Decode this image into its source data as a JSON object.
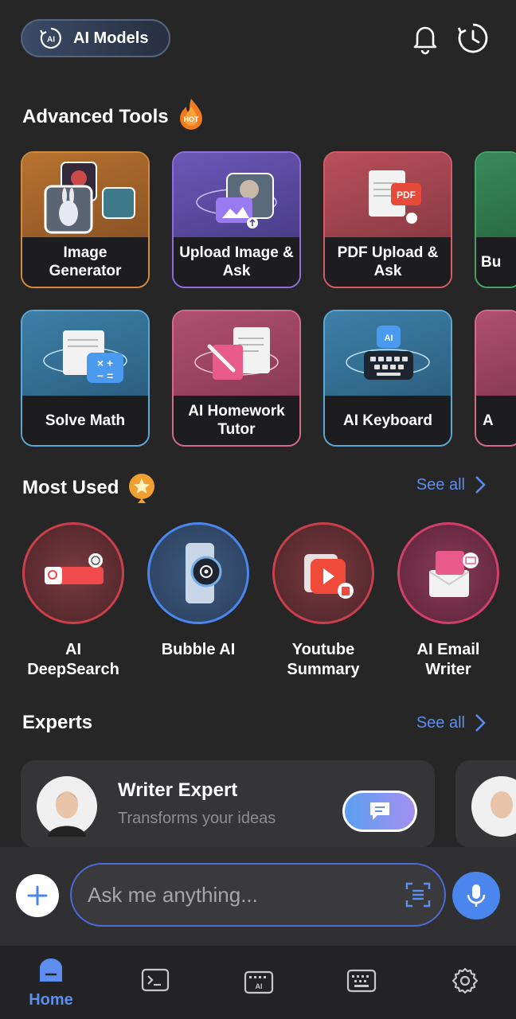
{
  "header": {
    "ai_models_label": "AI Models",
    "ai_badge_text": "AI",
    "icons": [
      "bell-icon",
      "history-icon"
    ]
  },
  "advanced_tools": {
    "title": "Advanced Tools",
    "hot_badge": "HOT",
    "tools": [
      {
        "label": "Image Generator",
        "color": "#d48a3a"
      },
      {
        "label": "Upload Image & Ask",
        "color": "#8a6ee0"
      },
      {
        "label": "PDF Upload & Ask",
        "color": "#d65a6a"
      },
      {
        "label": "Bu",
        "color": "#4aa06a"
      },
      {
        "label": "Solve Math",
        "color": "#5aa8d8"
      },
      {
        "label": "AI Homework Tutor",
        "color": "#d56a8a"
      },
      {
        "label": "AI Keyboard",
        "color": "#5aa8d8"
      },
      {
        "label": "A",
        "color": "#d56a8a"
      }
    ],
    "pdf_badge": "PDF",
    "keyboard_badge": "AI"
  },
  "most_used": {
    "title": "Most Used",
    "see_all": "See all",
    "items": [
      {
        "label": "AI DeepSearch"
      },
      {
        "label": "Bubble AI"
      },
      {
        "label": "Youtube Summary"
      },
      {
        "label": "AI Email Writer"
      }
    ]
  },
  "experts": {
    "title": "Experts",
    "see_all": "See all",
    "card": {
      "name": "Writer Expert",
      "description": "Transforms your ideas"
    }
  },
  "chat": {
    "placeholder": "Ask me anything..."
  },
  "nav": {
    "home_label": "Home",
    "items": [
      "home-icon",
      "terminal-icon",
      "ai-keyboard-icon",
      "keyboard-icon",
      "settings-icon"
    ],
    "ai_keyboard_text": "AI"
  },
  "colors": {
    "accent": "#5c8ef0",
    "background": "#262626"
  }
}
